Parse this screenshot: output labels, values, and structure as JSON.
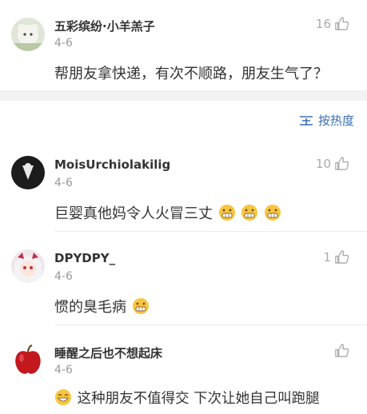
{
  "post": {
    "username": "五彩缤纷·小羊羔子",
    "date": "4-6",
    "likes": "16",
    "text": "帮朋友拿快递，有次不顺路，朋友生气了？"
  },
  "sort": {
    "label": "按热度",
    "icon": "sort-lines-icon"
  },
  "comments": [
    {
      "username": "MoisUrchiolakilig",
      "date": "4-6",
      "likes": "10",
      "text": "巨婴真他妈令人火冒三丈",
      "emoji_count": 3
    },
    {
      "username": "DPYDPY_",
      "date": "4-6",
      "likes": "1",
      "text": "惯的臭毛病",
      "emoji_count": 1
    },
    {
      "username": "睡醒之后也不想起床",
      "date": "4-6",
      "likes": "",
      "text": "这种朋友不值得交 下次让她自己叫跑腿",
      "emoji_count": 1
    }
  ],
  "colors": {
    "accent": "#3a6fb0",
    "muted": "#999999",
    "separator": "#f2f2f2"
  }
}
